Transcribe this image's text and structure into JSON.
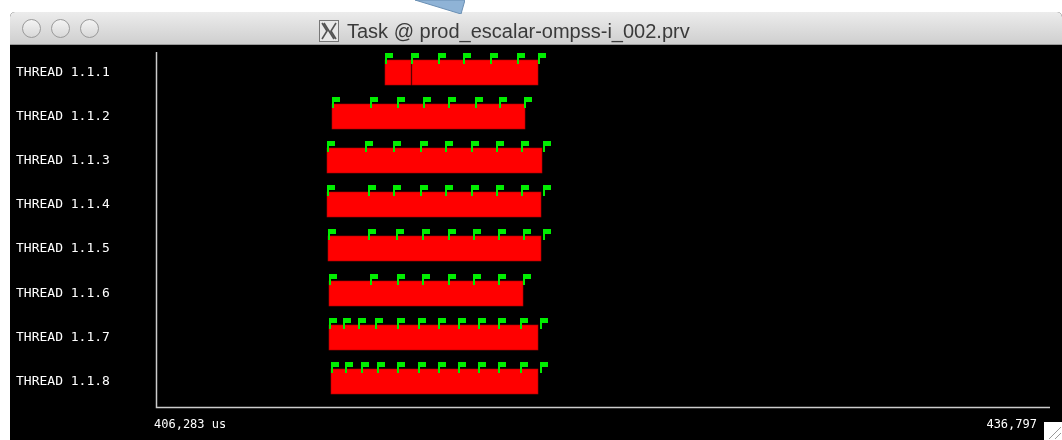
{
  "window": {
    "title": "Task @ prod_escalar-ompss-i_002.prv"
  },
  "threads": [
    {
      "label": "THREAD 1.1.1"
    },
    {
      "label": "THREAD 1.1.2"
    },
    {
      "label": "THREAD 1.1.3"
    },
    {
      "label": "THREAD 1.1.4"
    },
    {
      "label": "THREAD 1.1.5"
    },
    {
      "label": "THREAD 1.1.6"
    },
    {
      "label": "THREAD 1.1.7"
    },
    {
      "label": "THREAD 1.1.8"
    }
  ],
  "time_axis": {
    "start": "406,283 us",
    "end": "436,797"
  }
}
